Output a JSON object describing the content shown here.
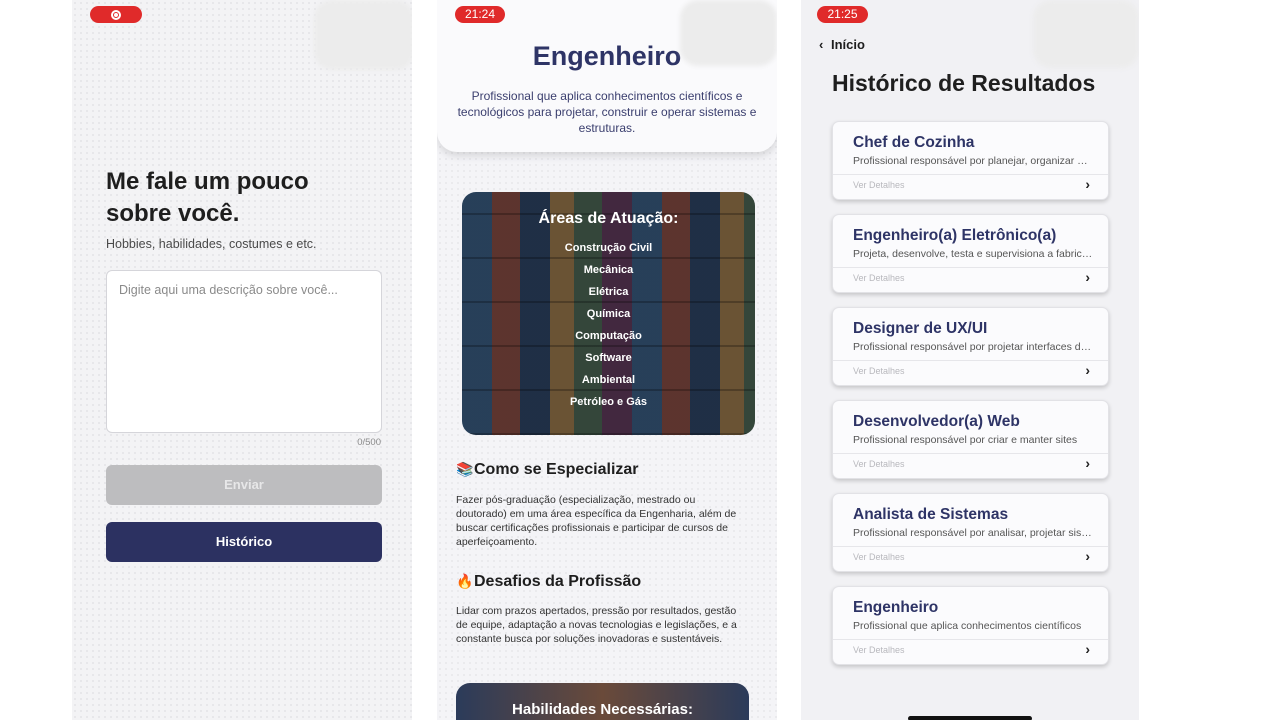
{
  "screen1": {
    "title": "Me fale um pouco sobre você.",
    "subtitle": "Hobbies, habilidades, costumes e etc.",
    "textarea_placeholder": "Digite aqui uma descrição sobre você...",
    "char_count": "0/500",
    "send_label": "Enviar",
    "history_label": "Histórico"
  },
  "screen2": {
    "status_time": "21:24",
    "title": "Engenheiro",
    "description": "Profissional que aplica conhecimentos científicos e tecnológicos para projetar, construir e operar sistemas e estruturas.",
    "areas_title": "Áreas de Atuação:",
    "areas": [
      "Construção Civil",
      "Mecânica",
      "Elétrica",
      "Química",
      "Computação",
      "Software",
      "Ambiental",
      "Petróleo e Gás"
    ],
    "specialize_icon": "books-icon",
    "specialize_title": "Como se Especializar",
    "specialize_text": "Fazer pós-graduação (especialização, mestrado ou doutorado) em uma área específica da Engenharia, além de buscar certificações profissionais e participar de cursos de aperfeiçoamento.",
    "challenges_icon": "fire-icon",
    "challenges_title": "Desafios da Profissão",
    "challenges_text": "Lidar com prazos apertados, pressão por resultados, gestão de equipe,  adaptação a novas tecnologias e legislações,  e a constante busca por soluções inovadoras e sustentáveis.",
    "skills_title": "Habilidades Necessárias:"
  },
  "screen3": {
    "status_time": "21:25",
    "back_label": "Início",
    "title": "Histórico de Resultados",
    "details_label": "Ver Detalhes",
    "results": [
      {
        "title": "Chef de Cozinha",
        "desc": "Profissional responsável por planejar, organizar e supervisionar"
      },
      {
        "title": "Engenheiro(a) Eletrônico(a)",
        "desc": "Projeta, desenvolve, testa e supervisiona a fabricação"
      },
      {
        "title": "Designer de UX/UI",
        "desc": "Profissional responsável por projetar interfaces digitais"
      },
      {
        "title": "Desenvolvedor(a) Web",
        "desc": "Profissional responsável por criar e manter sites"
      },
      {
        "title": "Analista de Sistemas",
        "desc": "Profissional responsável por analisar, projetar sistemas"
      },
      {
        "title": "Engenheiro",
        "desc": "Profissional que aplica conhecimentos científicos"
      }
    ]
  },
  "colors": {
    "primary": "#2c3161",
    "status_pill": "#e02a2a",
    "disabled_button": "#bdbdbf"
  }
}
